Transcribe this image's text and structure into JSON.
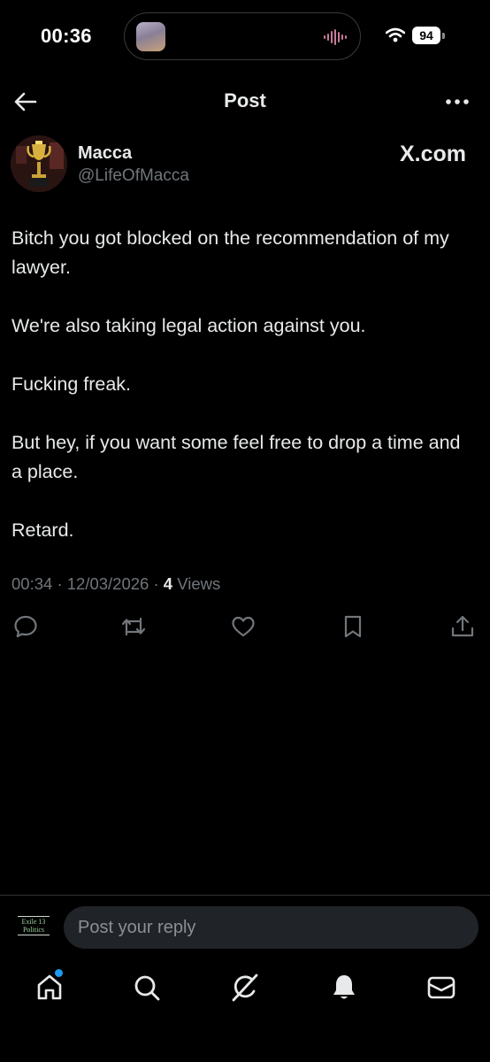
{
  "status_bar": {
    "time": "00:36",
    "battery": "94"
  },
  "header": {
    "title": "Post"
  },
  "author": {
    "name": "Macca",
    "handle": "@LifeOfMacca",
    "badge_text": "X.com"
  },
  "post": {
    "paragraphs": [
      "Bitch you got blocked on the recommendation of my lawyer.",
      "We're also taking legal action against you.",
      "Fucking freak.",
      "But hey, if you want some feel free to drop a time and a place.",
      "Retard."
    ],
    "time": "00:34",
    "date": "12/03/2026",
    "views_count": "4",
    "views_label": "Views"
  },
  "actions": [
    "reply-icon",
    "retweet-icon",
    "like-icon",
    "bookmark-icon",
    "share-icon"
  ],
  "reply": {
    "avatar_text_line1": "Exile 13",
    "avatar_text_line2": "Politics",
    "placeholder": "Post your reply"
  },
  "bottom_nav": [
    "home-icon",
    "search-icon",
    "grok-icon",
    "notifications-icon",
    "messages-icon"
  ],
  "colors": {
    "background": "#000000",
    "text": "#e7e9ea",
    "secondary_text": "#71767b",
    "accent": "#1d9bf0",
    "input_background": "#202327"
  }
}
